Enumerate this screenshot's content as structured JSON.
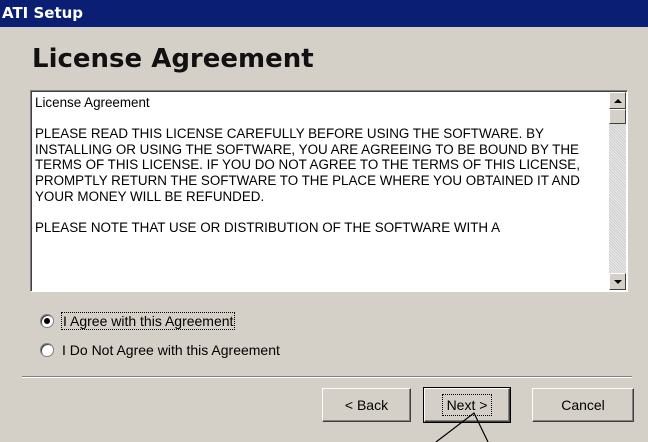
{
  "window": {
    "title": "ATI Setup"
  },
  "page": {
    "heading": "License Agreement"
  },
  "license": {
    "paragraphs": [
      "License Agreement",
      "PLEASE READ THIS LICENSE CAREFULLY BEFORE USING THE SOFTWARE. BY INSTALLING OR USING THE SOFTWARE, YOU ARE AGREEING TO BE BOUND BY THE TERMS OF THIS LICENSE.  IF YOU DO NOT AGREE TO THE TERMS OF THIS LICENSE, PROMPTLY RETURN THE SOFTWARE TO THE PLACE WHERE YOU OBTAINED IT AND YOUR MONEY WILL BE REFUNDED.",
      "PLEASE NOTE THAT USE OR DISTRIBUTION OF THE SOFTWARE WITH A"
    ]
  },
  "options": {
    "agree_label": "I Agree with this Agreement",
    "disagree_label": "I Do Not Agree with this Agreement",
    "selected": "agree"
  },
  "buttons": {
    "back": "< Back",
    "next": "Next >",
    "cancel": "Cancel"
  }
}
